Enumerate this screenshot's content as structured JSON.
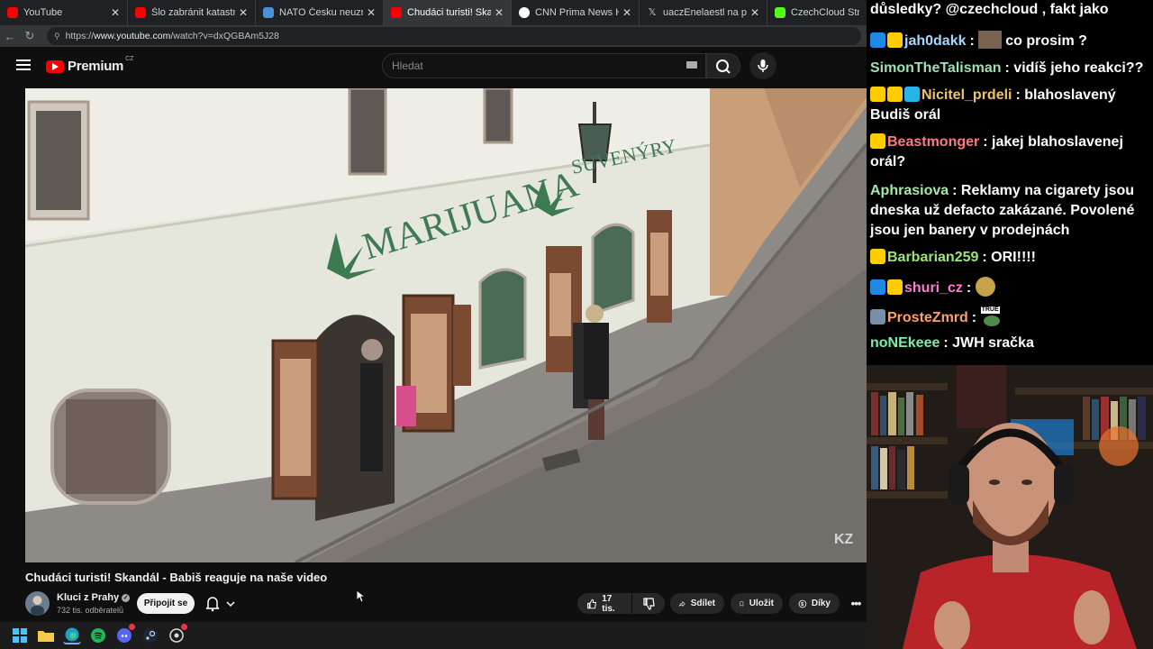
{
  "browser": {
    "tabs": [
      {
        "title": "YouTube",
        "favicon": "youtube-icon",
        "color": "#ff0000",
        "active": false
      },
      {
        "title": "Šlo zabránit katastrofě v Čern",
        "favicon": "youtube-icon",
        "color": "#ff0000",
        "active": false
      },
      {
        "title": "NATO Česku neuznalo jako u",
        "favicon": "generic-page-icon",
        "color": "#4a90d9",
        "active": false
      },
      {
        "title": "Chudáci turisti! Skandál - Babi",
        "favicon": "youtube-icon",
        "color": "#ff0000",
        "active": true
      },
      {
        "title": "CNN Prima News HD Sledujte",
        "favicon": "cnn-icon",
        "color": "#ffffff",
        "active": false
      },
      {
        "title": "uaczEnelaestl na platformě X",
        "favicon": "x-icon",
        "color": "#cccccc",
        "active": false
      },
      {
        "title": "CzechCloud Stream - Wa",
        "favicon": "kick-icon",
        "color": "#53fc18",
        "active": false
      }
    ],
    "url_prefix": "https://",
    "url_host": "www.youtube.com",
    "url_path": "/watch?v=dxQGBAm5J28"
  },
  "youtube": {
    "logo_word": "Premium",
    "logo_region": "CZ",
    "search_placeholder": "Hledat",
    "video_title": "Chudáci turisti! Skandál - Babiš reaguje na naše video",
    "channel_name": "Kluci z Prahy",
    "channel_subs": "732 tis. odběratelů",
    "join_label": "Připojit se",
    "likes_label": "17 tis.",
    "share_label": "Sdílet",
    "save_label": "Uložit",
    "thanks_label": "Díky",
    "video_overlay": {
      "shop_sign": "MARIJUANA",
      "souvenir_sign": "SUVENÝRY",
      "watermark": "KZ"
    }
  },
  "chat": {
    "messages": [
      {
        "user": "",
        "user_color": "#ffffff",
        "text": "důsledky? @czechcloud , fakt jako",
        "badges": []
      },
      {
        "user": "jah0dakk",
        "user_color": "#a8d8ff",
        "text": "co prosim ?",
        "badges": [
          "#1e88e5",
          "#ffcc00"
        ],
        "emote": true
      },
      {
        "user": "SimonTheTalisman",
        "user_color": "#9ee0b3",
        "text": "vidíš jeho reakci??",
        "badges": []
      },
      {
        "user": "Nicitel_prdeli",
        "user_color": "#f0c36a",
        "text": "blahoslavený Budiš orál",
        "badges": [
          "#ffcc00",
          "#ffcc00",
          "#28b4e8"
        ]
      },
      {
        "user": "Beastmonger",
        "user_color": "#ff7a7a",
        "text": "jakej blahoslavenej orál?",
        "badges": [
          "#ffcc00"
        ]
      },
      {
        "user": "Aphrasiova",
        "user_color": "#a5e9a5",
        "text": "Reklamy na cigarety jsou dneska už defacto zakázané. Povolené jsou jen banery v prodejnách",
        "badges": []
      },
      {
        "user": "Barbarian259",
        "user_color": "#9be67a",
        "text": "ORI!!!!",
        "badges": [
          "#ffcc00"
        ]
      },
      {
        "user": "shuri_cz",
        "user_color": "#ff7ad0",
        "text": "",
        "badges": [
          "#1e88e5",
          "#ffcc00"
        ],
        "emote": true
      },
      {
        "user": "ProsteZmrd",
        "user_color": "#ff9f6a",
        "text": "",
        "badges": [
          "#7a8ea8"
        ],
        "emote": true,
        "emote_label": "TRUE"
      },
      {
        "user": "noNEkeee",
        "user_color": "#7cf0a8",
        "text": "JWH sračka",
        "badges": []
      }
    ]
  }
}
